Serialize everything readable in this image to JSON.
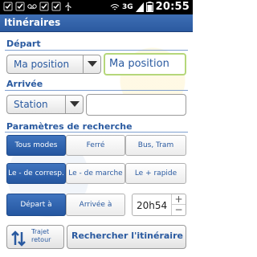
{
  "status": {
    "network": "3G",
    "time": "20:55"
  },
  "title": "Itinéraires",
  "depart": {
    "label": "Départ",
    "spinner_value": "Ma position",
    "field_value": "Ma position"
  },
  "arrivee": {
    "label": "Arrivée",
    "spinner_value": "Station",
    "field_value": ""
  },
  "params": {
    "label": "Paramètres de recherche",
    "modes": [
      "Tous modes",
      "Ferré",
      "Bus, Tram"
    ],
    "mode_selected": 0,
    "prefs": [
      "Le - de corresp.",
      "Le - de marche",
      "Le + rapide"
    ],
    "pref_selected": 0,
    "time_types": [
      "Départ à",
      "Arrivée à"
    ],
    "time_type_selected": 0,
    "time": "20h54",
    "plus": "+",
    "minus": "−"
  },
  "actions": {
    "swap_label": [
      "Trajet",
      "retour"
    ],
    "search_label": "Rechercher l'itinéraire"
  }
}
